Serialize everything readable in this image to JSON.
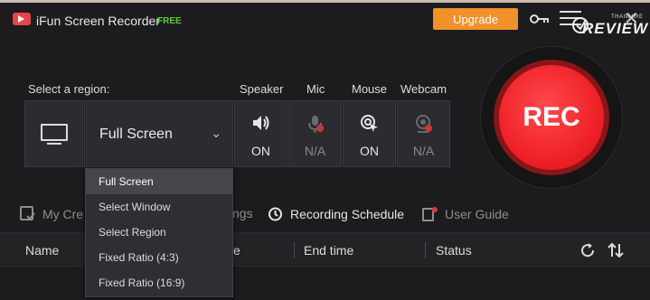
{
  "titlebar": {
    "app_name": "iFun Screen Recorder",
    "free_badge": "FREE",
    "upgrade_label": "Upgrade",
    "watermark_small": "THAIWARE",
    "watermark_big": "REVIEW"
  },
  "capture": {
    "region_label": "Select a region:",
    "region_value": "Full Screen",
    "speaker": {
      "label": "Speaker",
      "status": "ON"
    },
    "mic": {
      "label": "Mic",
      "status": "N/A"
    },
    "mouse": {
      "label": "Mouse",
      "status": "ON"
    },
    "webcam": {
      "label": "Webcam",
      "status": "N/A"
    }
  },
  "rec_label": "REC",
  "region_dropdown": {
    "items": [
      "Full Screen",
      "Select Window",
      "Select Region",
      "Fixed Ratio (4:3)",
      "Fixed Ratio (16:9)"
    ],
    "selected": "Full Screen"
  },
  "tabs": {
    "my_creations": "My Cre",
    "settings_tail": "ngs",
    "recording_schedule": "Recording Schedule",
    "user_guide": "User Guide"
  },
  "table": {
    "columns": {
      "name": "Name",
      "start_tail": "e",
      "end_time": "End time",
      "status": "Status"
    }
  },
  "colors": {
    "accent_orange": "#f0912a",
    "rec_red": "#ef2227",
    "free_green": "#5ec83a",
    "badge_red": "#e8434b"
  }
}
